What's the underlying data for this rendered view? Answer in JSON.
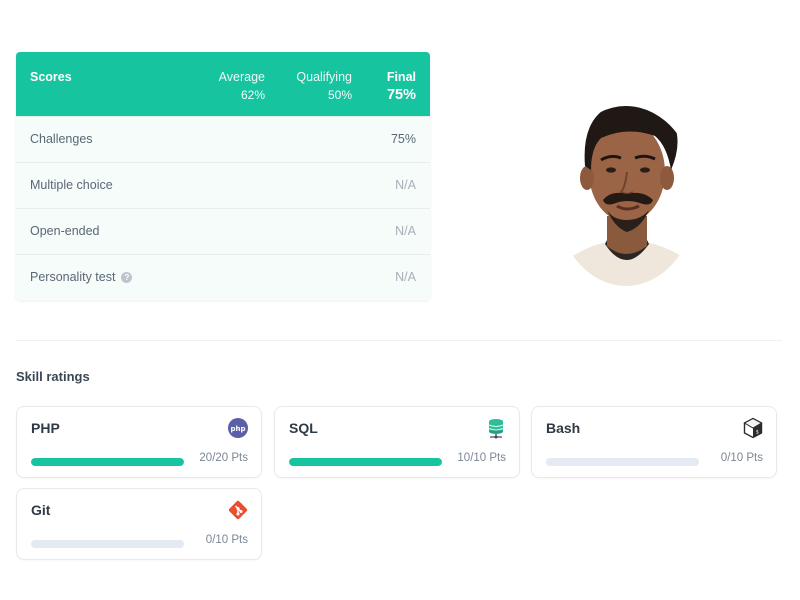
{
  "scores": {
    "title": "Scores",
    "columns": {
      "average": {
        "label": "Average",
        "value": "62%"
      },
      "qualifying": {
        "label": "Qualifying",
        "value": "50%"
      },
      "final": {
        "label": "Final",
        "value": "75%"
      }
    },
    "rows": [
      {
        "label": "Challenges",
        "value": "75%"
      },
      {
        "label": "Multiple choice",
        "value": "N/A"
      },
      {
        "label": "Open-ended",
        "value": "N/A"
      },
      {
        "label": "Personality test",
        "value": "N/A",
        "help_icon": "question-icon"
      }
    ],
    "header_color": "#16c4a0"
  },
  "skills": {
    "title": "Skill ratings",
    "items": [
      {
        "name": "PHP",
        "points": "20/20 Pts",
        "progress": 1.0,
        "icon": "php-icon"
      },
      {
        "name": "SQL",
        "points": "10/10 Pts",
        "progress": 1.0,
        "icon": "database-icon"
      },
      {
        "name": "Bash",
        "points": "0/10 Pts",
        "progress": 0.0,
        "icon": "terminal-cube-icon"
      },
      {
        "name": "Git",
        "points": "0/10 Pts",
        "progress": 0.0,
        "icon": "git-icon"
      }
    ],
    "accent_color": "#16c4a0",
    "empty_bar_color": "#e4eaf2"
  }
}
